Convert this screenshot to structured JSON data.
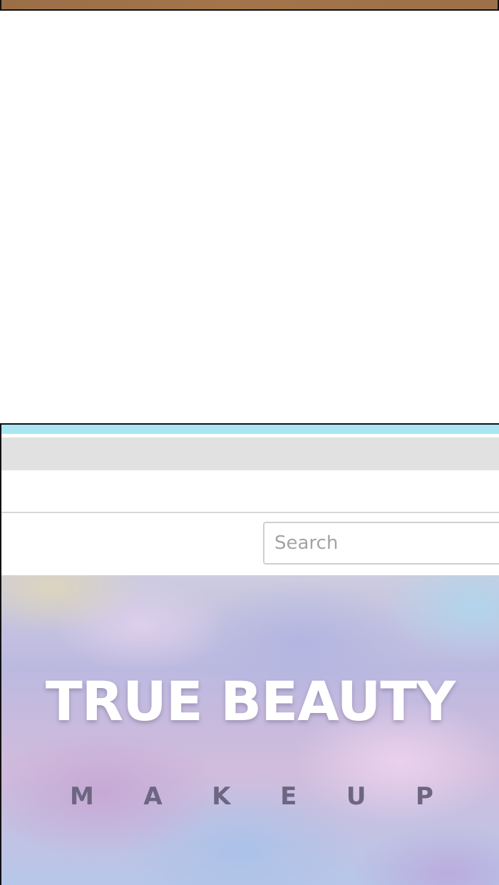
{
  "search": {
    "placeholder": "Search"
  },
  "hero": {
    "title": "TRUE BEAUTY",
    "subtitle_letters": [
      "M",
      "A",
      "K",
      "E",
      "U",
      "P"
    ]
  },
  "colors": {
    "top_panel": "#a2754b",
    "browser_topbar": "#a9e6f2",
    "tabstrip": "#e1e1e1",
    "subtitle": "#6d6682",
    "title": "#ffffff"
  }
}
